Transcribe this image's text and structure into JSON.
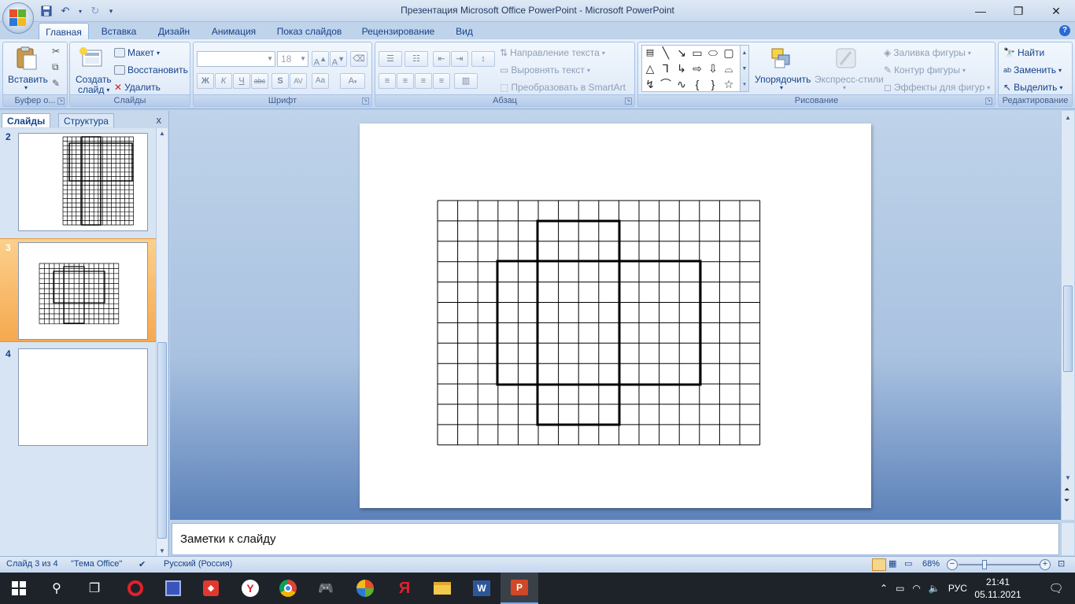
{
  "window": {
    "title": "Презентация Microsoft Office PowerPoint - Microsoft PowerPoint"
  },
  "ribbon_tabs": [
    {
      "label": "Главная",
      "active": true
    },
    {
      "label": "Вставка"
    },
    {
      "label": "Дизайн"
    },
    {
      "label": "Анимация"
    },
    {
      "label": "Показ слайдов"
    },
    {
      "label": "Рецензирование"
    },
    {
      "label": "Вид"
    }
  ],
  "groups": {
    "clipboard": {
      "label": "Буфер о...",
      "paste": "Вставить"
    },
    "slides": {
      "label": "Слайды",
      "create_line1": "Создать",
      "create_line2": "слайд",
      "layout": "Макет",
      "reset": "Восстановить",
      "delete": "Удалить"
    },
    "font": {
      "label": "Шрифт",
      "font_name": "",
      "font_size": "18"
    },
    "paragraph": {
      "label": "Абзац",
      "text_direction": "Направление текста",
      "align_text": "Выровнять текст",
      "smartart": "Преобразовать в SmartArt"
    },
    "drawing": {
      "label": "Рисование",
      "arrange": "Упорядочить",
      "quick_styles": "Экспресс-стили",
      "shape_fill": "Заливка фигуры",
      "shape_outline": "Контур фигуры",
      "shape_effects": "Эффекты для фигур"
    },
    "editing": {
      "label": "Редактирование",
      "find": "Найти",
      "replace": "Заменить",
      "select": "Выделить"
    }
  },
  "left_pane": {
    "tab_slides": "Слайды",
    "tab_outline": "Структура",
    "close": "x",
    "thumbnails": [
      {
        "number": "2"
      },
      {
        "number": "3",
        "selected": true
      },
      {
        "number": "4"
      }
    ]
  },
  "notes": {
    "placeholder": "Заметки к слайду"
  },
  "status": {
    "slide_info": "Слайд 3 из 4",
    "theme": "\"Тема Office\"",
    "language": "Русский (Россия)",
    "zoom": "68%"
  },
  "taskbar": {
    "tray_lang": "РУС",
    "time": "21:41",
    "date": "05.11.2021"
  },
  "colors": {
    "ribbon_text": "#15428b",
    "selected_thumb": "#f6a94f",
    "taskbar": "#1e2329"
  }
}
